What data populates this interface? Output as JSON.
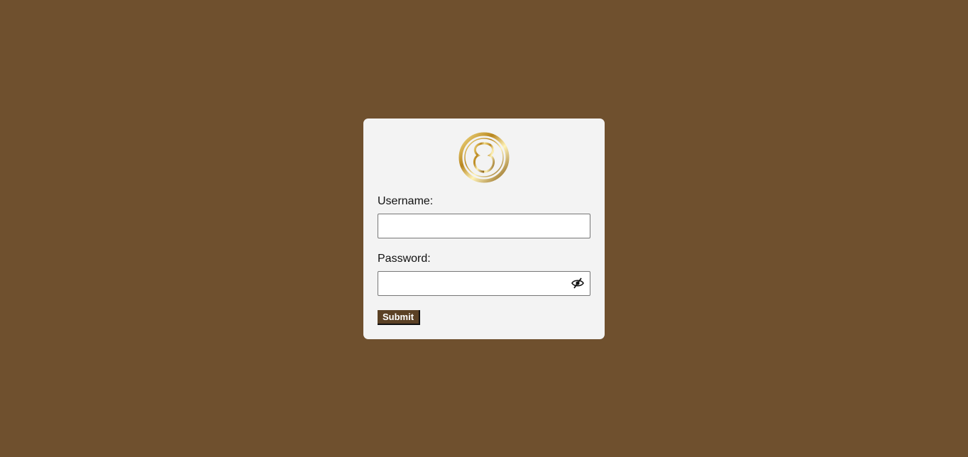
{
  "colors": {
    "background": "#6f502e",
    "card": "#f3f3f3",
    "button": "#5b4125",
    "logo_gold": "#c9a23a"
  },
  "login": {
    "logo_icon": "gold-ring-monogram-logo",
    "username_label": "Username:",
    "username_value": "",
    "password_label": "Password:",
    "password_value": "",
    "toggle_icon": "eye-slash-icon",
    "submit_label": "Submit"
  }
}
